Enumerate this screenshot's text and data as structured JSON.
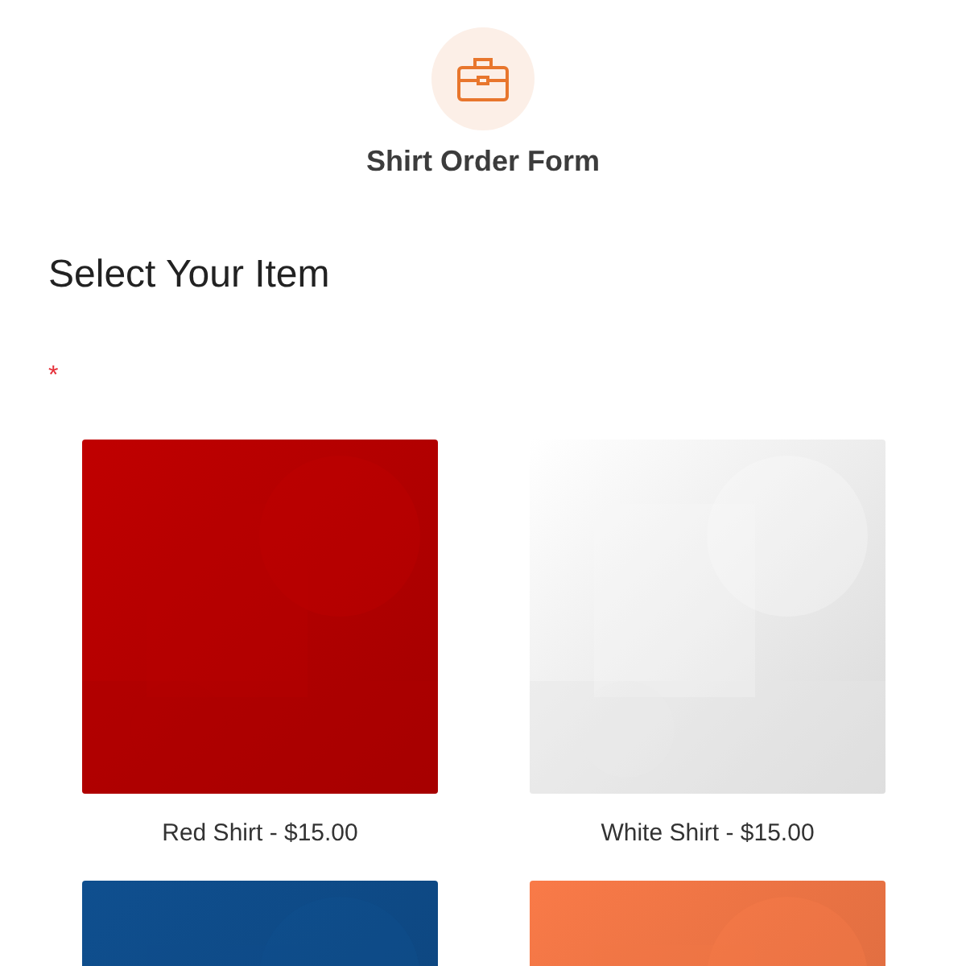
{
  "form": {
    "title": "Shirt Order Form"
  },
  "section": {
    "heading": "Select Your Item",
    "required_mark": "*"
  },
  "items": [
    {
      "label": "Red Shirt - $15.00",
      "color": "#c00000",
      "kind": "picture"
    },
    {
      "label": "White Shirt - $15.00",
      "color": "#ffffff",
      "kind": "picture"
    },
    {
      "color": "#0f4f8f",
      "kind": "picture"
    },
    {
      "color": "#f97a48",
      "kind": "picture"
    }
  ]
}
